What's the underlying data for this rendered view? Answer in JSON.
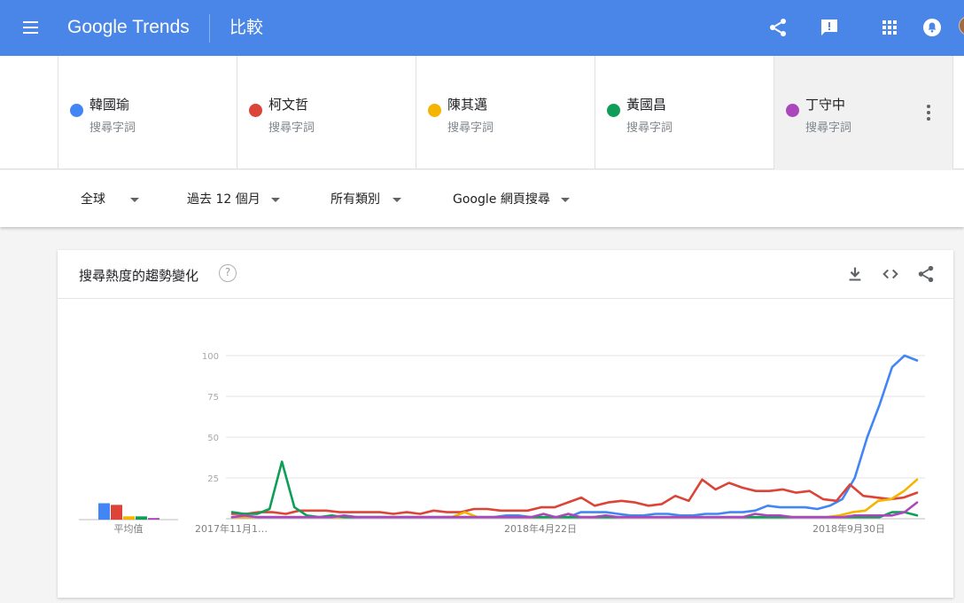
{
  "header": {
    "logo_google": "Google",
    "logo_trends": "Trends",
    "page_title": "比較",
    "icons": [
      "menu-icon",
      "share-icon",
      "feedback-icon",
      "apps-icon",
      "notifications-icon",
      "avatar"
    ],
    "bar_color": "#4a86e8"
  },
  "terms": [
    {
      "name": "韓國瑜",
      "sub": "搜尋字詞",
      "color": "#4285f4"
    },
    {
      "name": "柯文哲",
      "sub": "搜尋字詞",
      "color": "#db4437"
    },
    {
      "name": "陳其邁",
      "sub": "搜尋字詞",
      "color": "#f4b400"
    },
    {
      "name": "黃國昌",
      "sub": "搜尋字詞",
      "color": "#0f9d58"
    },
    {
      "name": "丁守中",
      "sub": "搜尋字詞",
      "color": "#ab47bc"
    }
  ],
  "filters": {
    "region": "全球",
    "time": "過去 12 個月",
    "category": "所有類別",
    "search_type": "Google 網頁搜尋"
  },
  "card": {
    "title": "搜尋熱度的趨勢變化",
    "help": "?",
    "icons": [
      "download-icon",
      "embed-icon",
      "share-icon"
    ]
  },
  "chart_data": {
    "type": "line",
    "title": "搜尋熱度的趨勢變化",
    "ylim": [
      0,
      100
    ],
    "yticks": [
      100,
      75,
      50,
      25
    ],
    "ytick_labels": [
      "100",
      "75",
      "50",
      "25"
    ],
    "xtick_labels": [
      "2017年11月1…",
      "2018年4月22日",
      "2018年9月30日"
    ],
    "grid": true,
    "series": [
      {
        "name": "韓國瑜",
        "color": "#4285f4",
        "values": [
          1,
          1,
          1,
          1,
          1,
          1,
          1,
          1,
          1,
          1,
          1,
          1,
          1,
          1,
          1,
          1,
          1,
          1,
          1,
          1,
          1,
          1,
          2,
          2,
          1,
          1,
          1,
          1,
          4,
          4,
          4,
          3,
          2,
          2,
          3,
          3,
          2,
          2,
          3,
          3,
          4,
          4,
          5,
          8,
          7,
          7,
          7,
          6,
          8,
          12,
          25,
          50,
          70,
          93,
          100,
          97
        ]
      },
      {
        "name": "柯文哲",
        "color": "#db4437",
        "values": [
          3,
          3,
          4,
          4,
          3,
          5,
          5,
          5,
          4,
          4,
          4,
          4,
          3,
          4,
          3,
          5,
          4,
          4,
          6,
          6,
          5,
          5,
          5,
          7,
          7,
          10,
          13,
          8,
          10,
          11,
          10,
          8,
          9,
          14,
          11,
          24,
          18,
          22,
          19,
          17,
          17,
          18,
          16,
          17,
          12,
          11,
          21,
          14,
          13,
          12,
          13,
          16
        ]
      },
      {
        "name": "陳其邁",
        "color": "#f4b400",
        "values": [
          1,
          1,
          1,
          1,
          1,
          1,
          1,
          1,
          1,
          1,
          1,
          1,
          1,
          1,
          1,
          1,
          1,
          1,
          4,
          1,
          1,
          1,
          1,
          1,
          1,
          1,
          1,
          1,
          1,
          1,
          1,
          1,
          1,
          1,
          1,
          1,
          1,
          1,
          1,
          1,
          1,
          1,
          1,
          1,
          1,
          1,
          1,
          2,
          4,
          5,
          11,
          12,
          17,
          24
        ]
      },
      {
        "name": "黃國昌",
        "color": "#0f9d58",
        "values": [
          4,
          3,
          3,
          6,
          35,
          7,
          2,
          1,
          2,
          1,
          1,
          1,
          1,
          1,
          1,
          1,
          1,
          1,
          1,
          1,
          1,
          1,
          1,
          1,
          1,
          1,
          1,
          1,
          1,
          1,
          1,
          1,
          1,
          1,
          1,
          1,
          1,
          1,
          1,
          1,
          1,
          1,
          1,
          1,
          1,
          1,
          1,
          1,
          1,
          1,
          1,
          1,
          1,
          4,
          4,
          2
        ]
      },
      {
        "name": "丁守中",
        "color": "#ab47bc",
        "values": [
          1,
          2,
          1,
          1,
          1,
          1,
          1,
          1,
          1,
          2,
          1,
          1,
          1,
          1,
          1,
          1,
          1,
          1,
          1,
          1,
          1,
          1,
          1,
          1,
          1,
          3,
          1,
          3,
          1,
          1,
          2,
          1,
          1,
          1,
          1,
          1,
          1,
          1,
          1,
          1,
          1,
          1,
          3,
          2,
          2,
          1,
          1,
          1,
          1,
          1,
          2,
          2,
          2,
          2,
          4,
          10
        ]
      }
    ],
    "average": {
      "label": "平均值",
      "values": [
        10,
        9,
        2,
        2,
        1
      ]
    }
  }
}
